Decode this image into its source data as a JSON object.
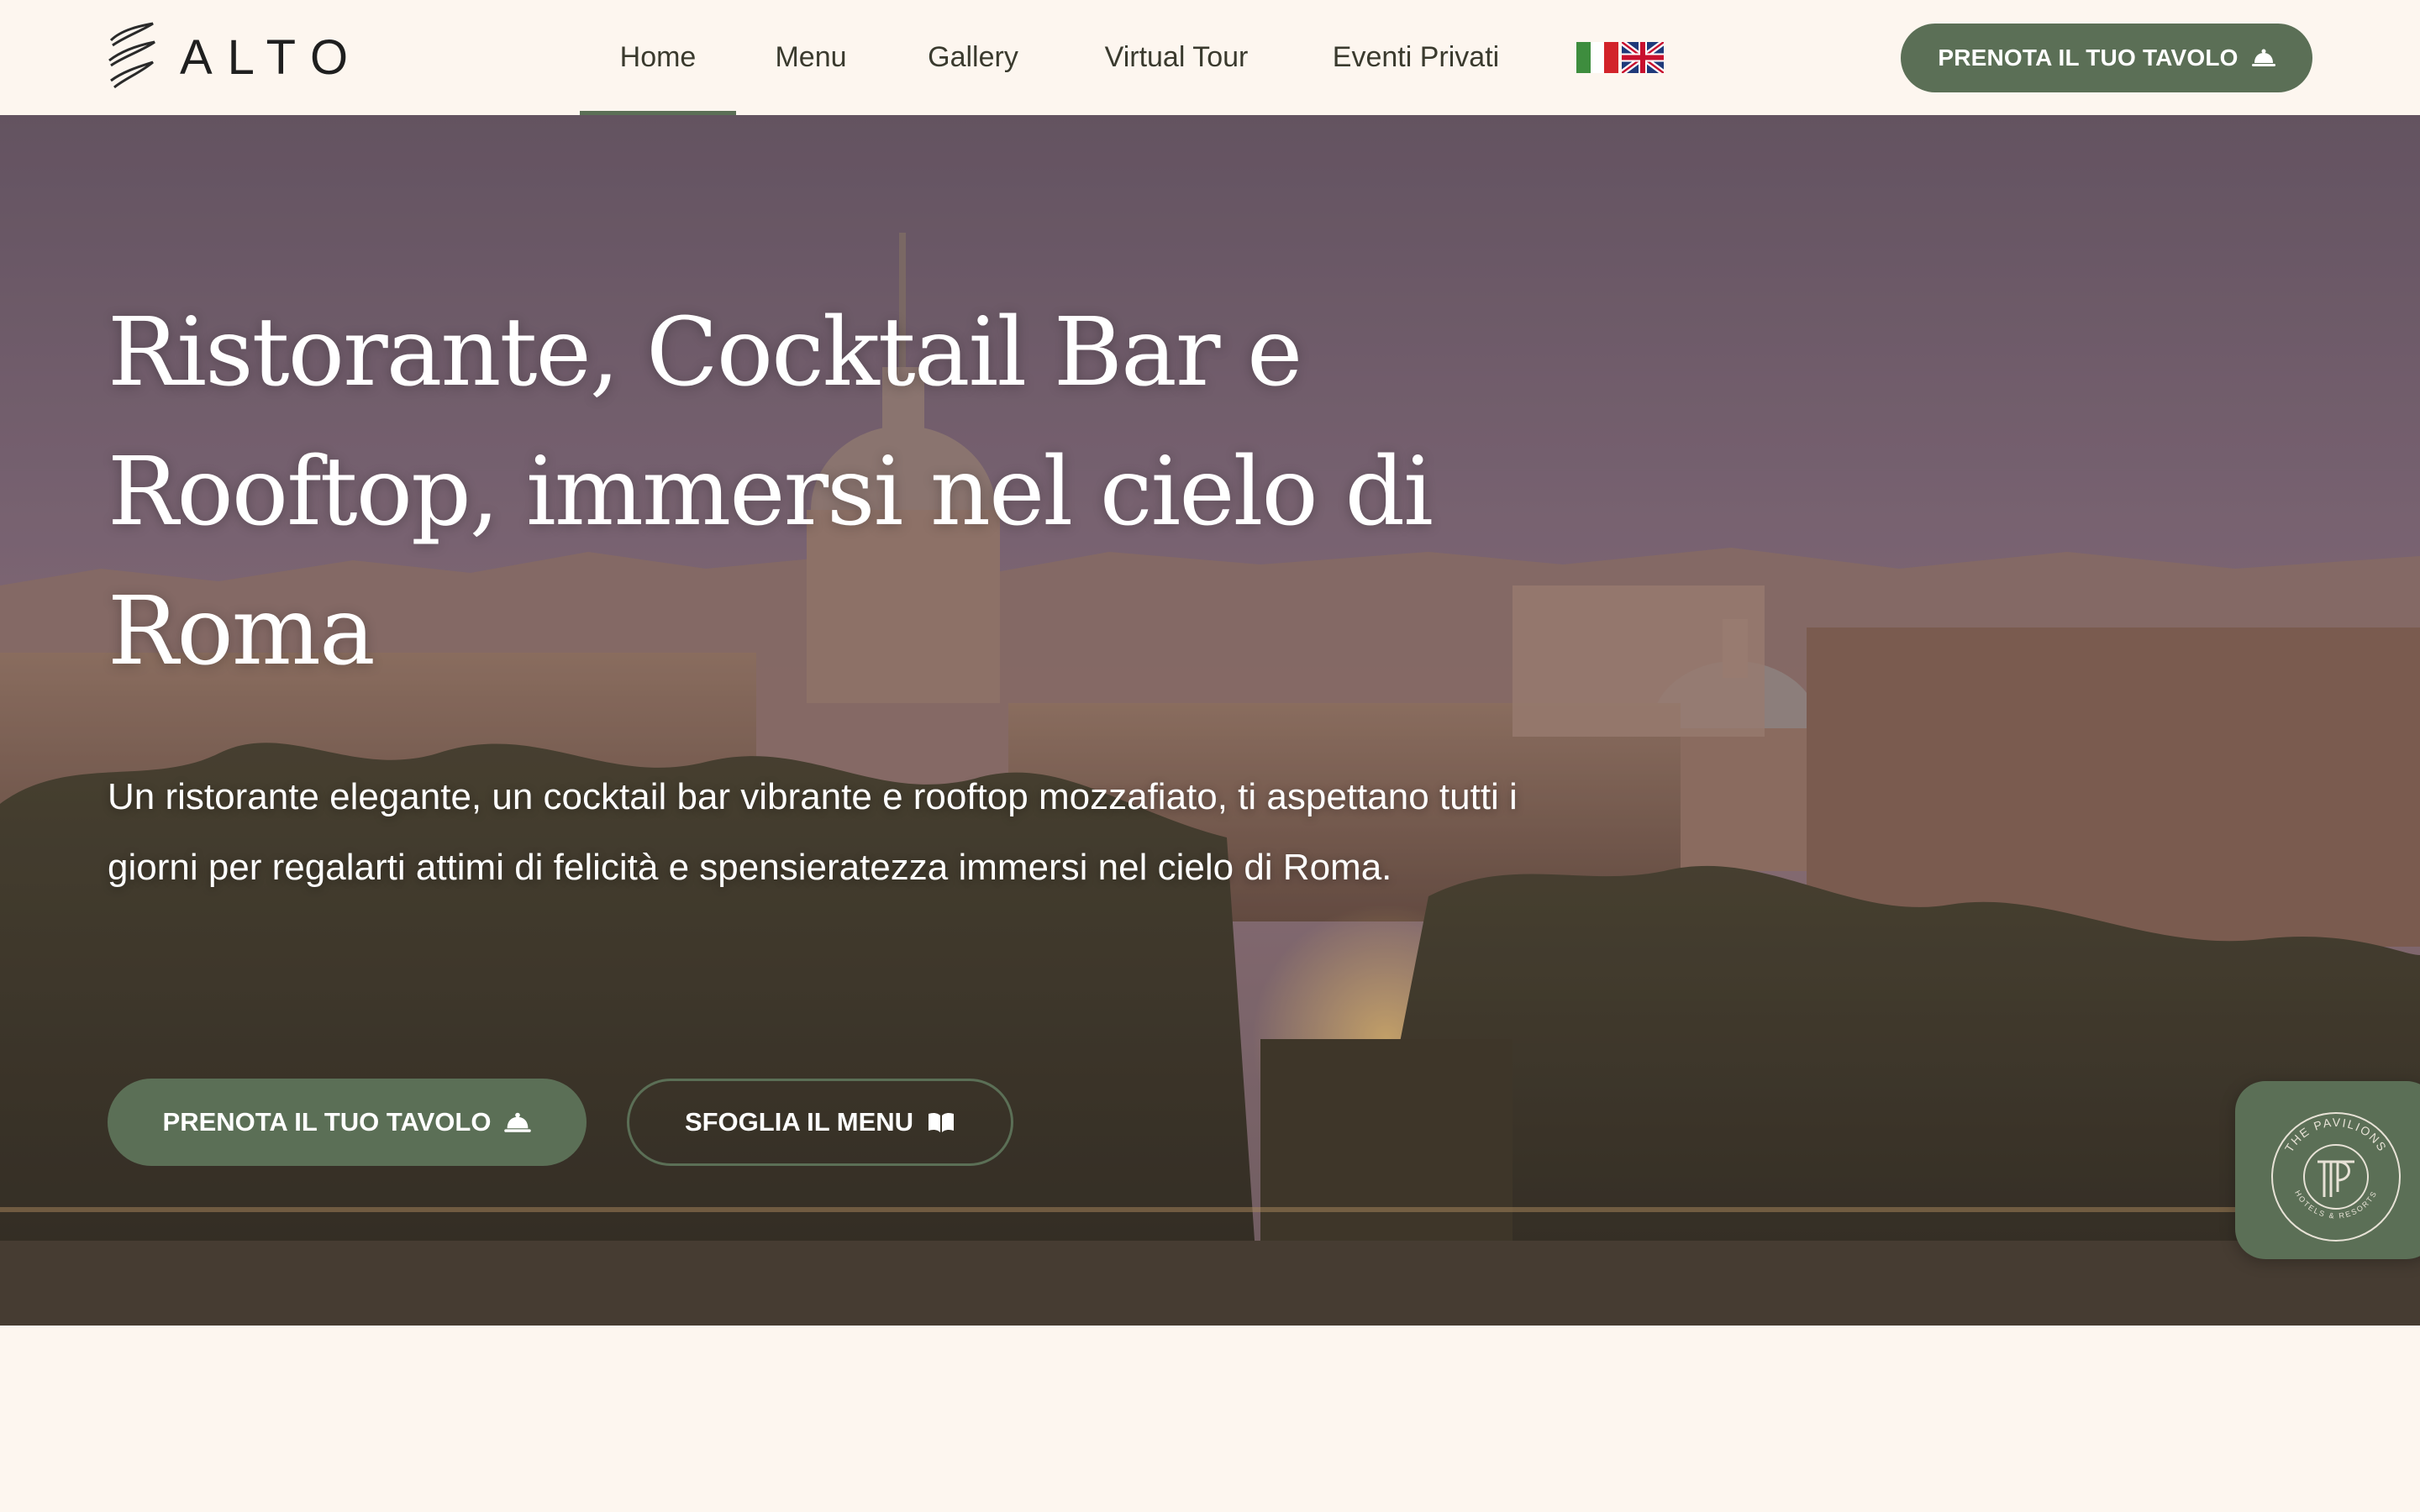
{
  "brand": {
    "name": "ALTO",
    "logo_icon": "alto-swirl-logo-icon"
  },
  "nav": {
    "items": [
      {
        "label": "Home",
        "active": true
      },
      {
        "label": "Menu",
        "active": false
      },
      {
        "label": "Gallery",
        "active": false
      },
      {
        "label": "Virtual Tour",
        "active": false
      },
      {
        "label": "Eventi Privati",
        "active": false
      }
    ],
    "languages": [
      {
        "icon": "italian-flag-icon"
      },
      {
        "icon": "uk-flag-icon"
      }
    ],
    "cta_label": "PRENOTA IL TUO TAVOLO",
    "cta_icon": "cloche-icon"
  },
  "hero": {
    "title": "Ristorante, Cocktail Bar e Rooftop, immersi nel cielo di Roma",
    "subtitle": "Un ristorante elegante, un cocktail bar vibrante e rooftop mozzafiato, ti aspettano tutti i giorni per regalarti attimi di felicità e spensieratezza immersi nel cielo di Roma.",
    "primary_button": {
      "label": "PRENOTA IL TUO TAVOLO",
      "icon": "cloche-icon"
    },
    "secondary_button": {
      "label": "SFOGLIA IL MENU",
      "icon": "open-book-icon"
    },
    "background": "rome-skyline-dusk-photo"
  },
  "badge": {
    "icon": "the-pavilions-logo-icon",
    "ring_text_top": "THE PAVILIONS",
    "ring_text_bottom": "HOTELS & RESORTS"
  },
  "colors": {
    "accent_green": "#5b6f56",
    "page_bg": "#fdf6ef",
    "nav_text": "#3a3a2e"
  }
}
